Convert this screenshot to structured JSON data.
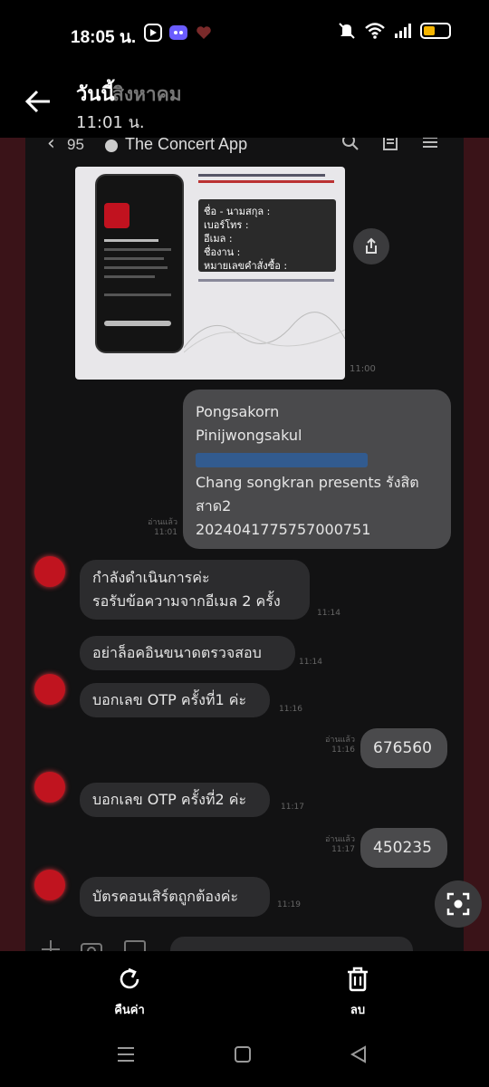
{
  "status_bar": {
    "time": "18:05 น.",
    "battery_level": 0.45,
    "accent": "#f4b400"
  },
  "header": {
    "title": "วันนี้",
    "title_ghost": "สิงหาคม",
    "time": "11:01 น."
  },
  "chat_app": {
    "back_count": "95",
    "name": "The Concert App"
  },
  "shared_image": {
    "form_lines": [
      "ชื่อ - นามสกุล :",
      "เบอร์โทร :",
      "อีเมล :",
      "ชื่องาน :",
      "หมายเลขคำสั่งซื้อ :"
    ],
    "time": "11:00"
  },
  "messages": {
    "contact": {
      "line1": "Pongsakorn",
      "line2": "Pinijwongsakul",
      "line3": "Chang songkran presents รังสิต",
      "line4": "สาด2",
      "line5": "2024041775757000751",
      "meta": "อ่านแล้ว\n11:01"
    },
    "m1": {
      "line1": "กำลังดำเนินการค่ะ",
      "line2": "รอรับข้อความจากอีเมล 2 ครั้ง",
      "time": "11:14"
    },
    "m2": {
      "text": "อย่าล็อคอินขนาดตรวจสอบ",
      "time": "11:14"
    },
    "m3": {
      "text": "บอกเลข OTP ครั้งที่1 ค่ะ",
      "time": "11:16"
    },
    "m4": {
      "text": "676560",
      "meta": "อ่านแล้ว\n11:16"
    },
    "m5": {
      "text": "บอกเลข OTP ครั้งที่2 ค่ะ",
      "time": "11:17"
    },
    "m6": {
      "text": "450235",
      "meta": "อ่านแล้ว\n11:17"
    },
    "m7": {
      "text": "บัตรคอนเสิร์ตถูกต้องค่ะ",
      "time": "11:19"
    }
  },
  "actions": {
    "restore": "คืนค่า",
    "delete": "ลบ"
  },
  "icons": [
    "back-arrow-icon",
    "share-icon",
    "lens-scan-icon",
    "restore-icon",
    "trash-icon",
    "menu-nav-icon",
    "home-nav-icon",
    "back-nav-icon"
  ]
}
